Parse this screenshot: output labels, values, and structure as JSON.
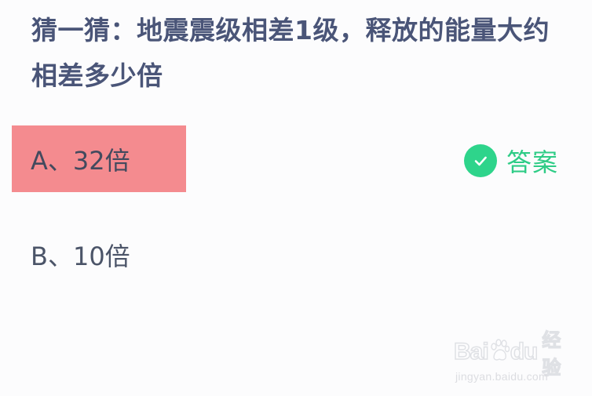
{
  "question": {
    "text": "猜一猜：地震震级相差1级，释放的能量大约相差多少倍"
  },
  "options": [
    {
      "label": "A、32倍",
      "state": "highlighted",
      "highlight_color": "#f48b8f"
    },
    {
      "label": "B、10倍"
    }
  ],
  "answer": {
    "label": "答案",
    "icon": "check-circle-icon",
    "color": "#2ed48b"
  },
  "watermark": {
    "brand_bai": "Bai",
    "brand_du": "du",
    "brand_suffix": "经验",
    "url": "jingyan.baidu.com"
  }
}
